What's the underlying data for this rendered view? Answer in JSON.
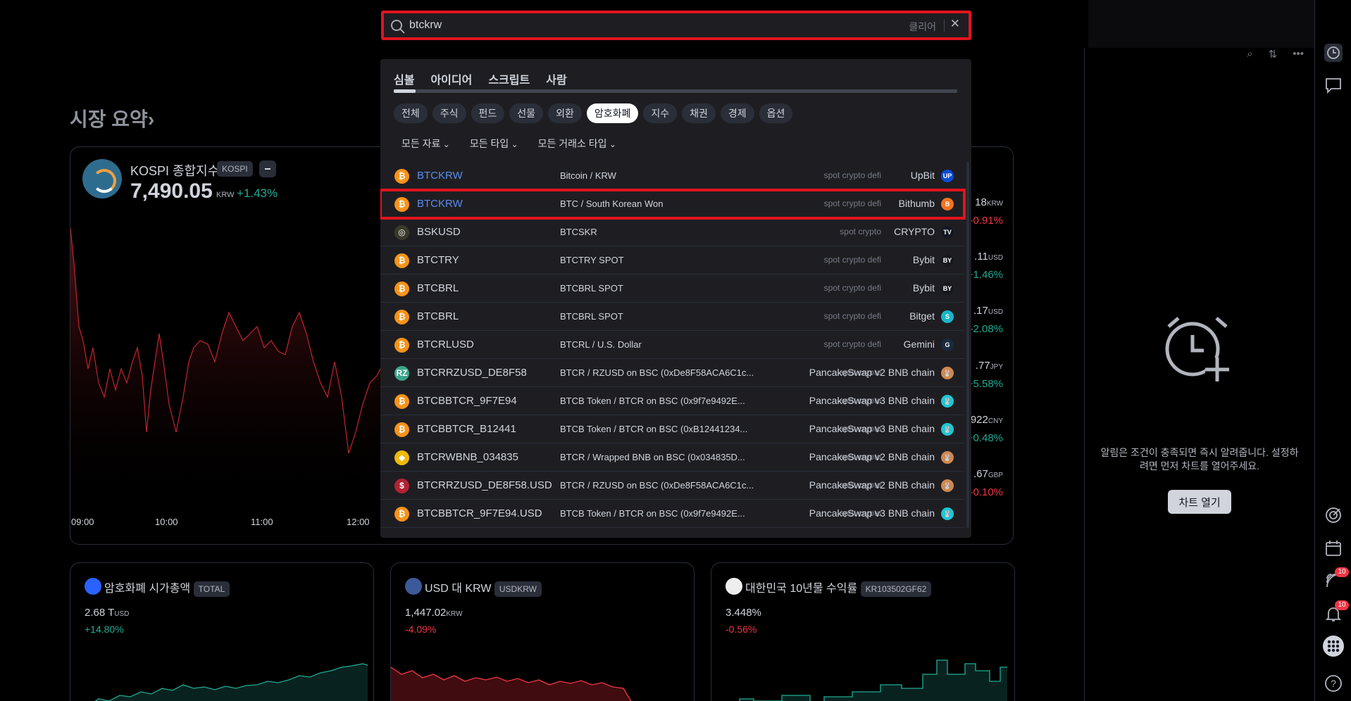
{
  "market": {
    "title": "시장 요약›",
    "kospi": {
      "name": "KOSPI 종합지수",
      "tag": "KOSPI",
      "value": "7,490.05",
      "unit": "KRW",
      "change": "+1.43%"
    },
    "times": [
      "09:00",
      "10:00",
      "11:00",
      "12:00"
    ],
    "side_quotes": [
      {
        "value": "18",
        "unit": "KRW",
        "change": "-0.91%",
        "color": "#f23645"
      },
      {
        "value": ".11",
        "unit": "USD",
        "change": "+1.46%",
        "color": "#22ab94"
      },
      {
        "value": ".17",
        "unit": "USD",
        "change": "-2.08%",
        "color": "#22ab94"
      },
      {
        "value": ".77",
        "unit": "JPY",
        "change": "+5.58%",
        "color": "#22ab94"
      },
      {
        "value": "922",
        "unit": "CNY",
        "change": "+0.48%",
        "color": "#22ab94"
      },
      {
        "value": ".67",
        "unit": "GBP",
        "change": "-0.10%",
        "color": "#f23645"
      }
    ],
    "cards": [
      {
        "title": "암호화폐 시가총액",
        "tag": "TOTAL",
        "value": "2.68 T",
        "unit": "USD",
        "change": "+14.80%",
        "change_color": "#22ab94"
      },
      {
        "title": "USD 대 KRW",
        "tag": "USDKRW",
        "value": "1,447.02",
        "unit": "KRW",
        "change": "-4.09%",
        "change_color": "#f23645"
      },
      {
        "title": "대한민국 10년물 수익률",
        "tag": "KR103502GF62",
        "value": "3.448%",
        "unit": "",
        "change": "-0.56%",
        "change_color": "#f23645"
      }
    ]
  },
  "search": {
    "value": "btckrw",
    "clear_label": "클리어",
    "close_label": "✕"
  },
  "dropdown": {
    "tabs": [
      "심볼",
      "아이디어",
      "스크립트",
      "사람"
    ],
    "filters": [
      "전체",
      "주식",
      "펀드",
      "선물",
      "외환",
      "암호화폐",
      "지수",
      "채권",
      "경제",
      "옵션"
    ],
    "active_filter": "암호화폐",
    "sub_filters": [
      "모든 자료",
      "모든 타입",
      "모든 거래소 타입"
    ],
    "results": [
      {
        "symbol": "BTCKRW",
        "desc": "Bitcoin / KRW",
        "tags": "spot crypto defi",
        "exchange": "UpBit",
        "icon": "₿",
        "icon_color": "#f7931a",
        "ex_icon": "UP",
        "ex_color": "#0a4bd8",
        "blue": true
      },
      {
        "symbol": "BTCKRW",
        "desc": "BTC / South Korean Won",
        "tags": "spot crypto defi",
        "exchange": "Bithumb",
        "icon": "₿",
        "icon_color": "#f7931a",
        "ex_icon": "B",
        "ex_color": "#f37321",
        "blue": true,
        "highlight": true
      },
      {
        "symbol": "BSKUSD",
        "desc": "BTCSKR",
        "tags": "spot crypto",
        "exchange": "CRYPTO",
        "icon": "◎",
        "icon_color": "#3a3a2a",
        "ex_icon": "TV",
        "ex_color": "#131722"
      },
      {
        "symbol": "BTCTRY",
        "desc": "BTCTRY SPOT",
        "tags": "spot crypto defi",
        "exchange": "Bybit",
        "icon": "₿",
        "icon_color": "#f7931a",
        "ex_icon": "BY",
        "ex_color": "#17181e"
      },
      {
        "symbol": "BTCBRL",
        "desc": "BTCBRL SPOT",
        "tags": "spot crypto defi",
        "exchange": "Bybit",
        "icon": "₿",
        "icon_color": "#f7931a",
        "ex_icon": "BY",
        "ex_color": "#17181e"
      },
      {
        "symbol": "BTCBRL",
        "desc": "BTCBRL SPOT",
        "tags": "spot crypto defi",
        "exchange": "Bitget",
        "icon": "₿",
        "icon_color": "#f7931a",
        "ex_icon": "S",
        "ex_color": "#1ab6c9"
      },
      {
        "symbol": "BTCRLUSD",
        "desc": "BTCRL / U.S. Dollar",
        "tags": "spot crypto defi",
        "exchange": "Gemini",
        "icon": "₿",
        "icon_color": "#f7931a",
        "ex_icon": "G",
        "ex_color": "#1b2a40"
      },
      {
        "symbol": "BTCRRZUSD_DE8F58",
        "desc": "BTCR / RZUSD on BSC (0xDe8F58ACA6C1c...",
        "tags": "spot crypto",
        "exchange": "PancakeSwap v2 BNB chain",
        "icon": "RZ",
        "icon_color": "#3aa58a",
        "ex_icon": "🐰",
        "ex_color": "#d1884f"
      },
      {
        "symbol": "BTCBBTCR_9F7E94",
        "desc": "BTCB Token / BTCR on BSC (0x9f7e9492E...",
        "tags": "spot crypto",
        "exchange": "PancakeSwap v3 BNB chain",
        "icon": "₿",
        "icon_color": "#f7931a",
        "ex_icon": "🐰",
        "ex_color": "#1fc7d4"
      },
      {
        "symbol": "BTCBBTCR_B12441",
        "desc": "BTCB Token / BTCR on BSC (0xB12441234...",
        "tags": "spot crypto",
        "exchange": "PancakeSwap v3 BNB chain",
        "icon": "₿",
        "icon_color": "#f7931a",
        "ex_icon": "🐰",
        "ex_color": "#1fc7d4"
      },
      {
        "symbol": "BTCRWBNB_034835",
        "desc": "BTCR / Wrapped BNB on BSC (0x034835D...",
        "tags": "spot crypto",
        "exchange": "PancakeSwap v2 BNB chain",
        "icon": "◆",
        "icon_color": "#f0b90b",
        "ex_icon": "🐰",
        "ex_color": "#d1884f"
      },
      {
        "symbol": "BTCRRZUSD_DE8F58.USD",
        "desc": "BTCR / RZUSD on BSC (0xDe8F58ACA6C1c...",
        "tags": "spot crypto",
        "exchange": "PancakeSwap v2 BNB chain",
        "icon": "$",
        "icon_color": "#b22234",
        "ex_icon": "🐰",
        "ex_color": "#d1884f"
      },
      {
        "symbol": "BTCBBTCR_9F7E94.USD",
        "desc": "BTCB Token / BTCR on BSC (0x9f7e9492E...",
        "tags": "spot crypto",
        "exchange": "PancakeSwap v3 BNB chain",
        "icon": "₿",
        "icon_color": "#f7931a",
        "ex_icon": "🐰",
        "ex_color": "#1fc7d4"
      }
    ]
  },
  "alerts": {
    "text": "알림은 조건이 충족되면 즉시 알려줍니다. 설정하려면 먼저 차트를 열어주세요.",
    "button": "차트 열기"
  },
  "right_bar": {
    "icons": [
      "clock-icon",
      "chat-icon",
      "target-icon",
      "calendar-icon",
      "signal-icon",
      "bell-icon",
      "apps-icon",
      "help-icon"
    ],
    "badge_signal": "10",
    "badge_bell": "10"
  }
}
